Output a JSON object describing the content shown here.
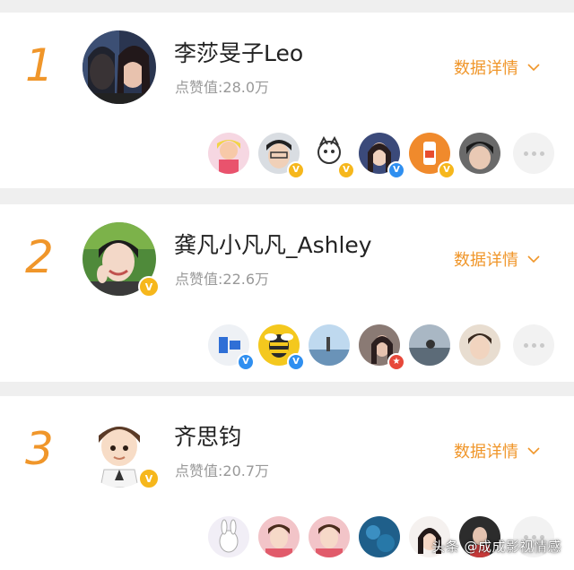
{
  "colors": {
    "accent": "#f0962a",
    "badge_gold": "#f6b71c",
    "badge_blue": "#2f8ff0"
  },
  "rankings": [
    {
      "rank": "1",
      "name": "李莎旻子Leo",
      "score": "点赞值:28.0万",
      "detail_label": "数据详情",
      "verified": false
    },
    {
      "rank": "2",
      "name": "龚凡小凡凡_Ashley",
      "score": "点赞值:22.6万",
      "detail_label": "数据详情",
      "verified": true
    },
    {
      "rank": "3",
      "name": "齐思钧",
      "score": "点赞值:20.7万",
      "detail_label": "数据详情",
      "verified": true
    }
  ],
  "watermark": "头条 @成成影视情感"
}
